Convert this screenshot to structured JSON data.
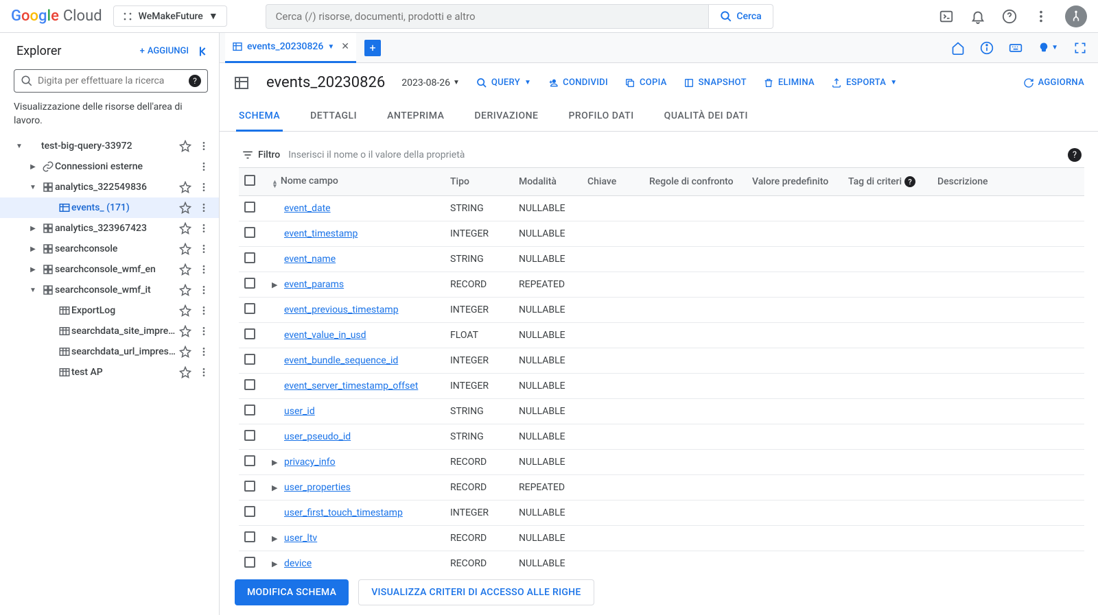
{
  "topbar": {
    "logo_cloud": "Cloud",
    "project": "WeMakeFuture",
    "search_placeholder": "Cerca (/) risorse, documenti, prodotti e altro",
    "search_btn": "Cerca"
  },
  "explorer": {
    "title": "Explorer",
    "add": "AGGIUNGI",
    "search_placeholder": "Digita per effettuare la ricerca",
    "hint": "Visualizzazione delle risorse dell'area di lavoro.",
    "tree": [
      {
        "lvl": 0,
        "icon": "caret-down",
        "ric": "",
        "label": "test-big-query-33972",
        "star": true,
        "more": true
      },
      {
        "lvl": 1,
        "icon": "caret-right",
        "ric": "link",
        "label": "Connessioni esterne",
        "star": false,
        "more": true
      },
      {
        "lvl": 1,
        "icon": "caret-down",
        "ric": "dataset",
        "label": "analytics_322549836",
        "star": true,
        "more": true
      },
      {
        "lvl": 2,
        "icon": "",
        "ric": "table-part",
        "label": "events_ (171)",
        "star": true,
        "more": true,
        "selected": true
      },
      {
        "lvl": 1,
        "icon": "caret-right",
        "ric": "dataset",
        "label": "analytics_323967423",
        "star": true,
        "more": true
      },
      {
        "lvl": 1,
        "icon": "caret-right",
        "ric": "dataset",
        "label": "searchconsole",
        "star": true,
        "more": true
      },
      {
        "lvl": 1,
        "icon": "caret-right",
        "ric": "dataset",
        "label": "searchconsole_wmf_en",
        "star": true,
        "more": true
      },
      {
        "lvl": 1,
        "icon": "caret-down",
        "ric": "dataset",
        "label": "searchconsole_wmf_it",
        "star": true,
        "more": true
      },
      {
        "lvl": 2,
        "icon": "",
        "ric": "table",
        "label": "ExportLog",
        "star": true,
        "more": true
      },
      {
        "lvl": 2,
        "icon": "",
        "ric": "table",
        "label": "searchdata_site_impres...",
        "star": true,
        "more": true
      },
      {
        "lvl": 2,
        "icon": "",
        "ric": "table",
        "label": "searchdata_url_impress...",
        "star": true,
        "more": true
      },
      {
        "lvl": 2,
        "icon": "",
        "ric": "table",
        "label": "test AP",
        "star": true,
        "more": true
      }
    ]
  },
  "tab": {
    "label": "events_20230826"
  },
  "page": {
    "title": "events_20230826",
    "date": "2023-08-26",
    "actions": {
      "query": "QUERY",
      "share": "CONDIVIDI",
      "copy": "COPIA",
      "snapshot": "SNAPSHOT",
      "delete": "ELIMINA",
      "export": "ESPORTA",
      "refresh": "AGGIORNA"
    },
    "subtabs": [
      "SCHEMA",
      "DETTAGLI",
      "ANTEPRIMA",
      "DERIVAZIONE",
      "PROFILO DATI",
      "QUALITÀ DEI DATI"
    ]
  },
  "filter": {
    "label": "Filtro",
    "placeholder": "Inserisci il nome o il valore della proprietà"
  },
  "table": {
    "headers": {
      "name": "Nome campo",
      "type": "Tipo",
      "mode": "Modalità",
      "key": "Chiave",
      "collation": "Regole di confronto",
      "default": "Valore predefinito",
      "tags": "Tag di criteri",
      "desc": "Descrizione"
    },
    "rows": [
      {
        "name": "event_date",
        "type": "STRING",
        "mode": "NULLABLE",
        "expandable": false
      },
      {
        "name": "event_timestamp",
        "type": "INTEGER",
        "mode": "NULLABLE",
        "expandable": false
      },
      {
        "name": "event_name",
        "type": "STRING",
        "mode": "NULLABLE",
        "expandable": false
      },
      {
        "name": "event_params",
        "type": "RECORD",
        "mode": "REPEATED",
        "expandable": true
      },
      {
        "name": "event_previous_timestamp",
        "type": "INTEGER",
        "mode": "NULLABLE",
        "expandable": false
      },
      {
        "name": "event_value_in_usd",
        "type": "FLOAT",
        "mode": "NULLABLE",
        "expandable": false
      },
      {
        "name": "event_bundle_sequence_id",
        "type": "INTEGER",
        "mode": "NULLABLE",
        "expandable": false
      },
      {
        "name": "event_server_timestamp_offset",
        "type": "INTEGER",
        "mode": "NULLABLE",
        "expandable": false
      },
      {
        "name": "user_id",
        "type": "STRING",
        "mode": "NULLABLE",
        "expandable": false
      },
      {
        "name": "user_pseudo_id",
        "type": "STRING",
        "mode": "NULLABLE",
        "expandable": false
      },
      {
        "name": "privacy_info",
        "type": "RECORD",
        "mode": "NULLABLE",
        "expandable": true
      },
      {
        "name": "user_properties",
        "type": "RECORD",
        "mode": "REPEATED",
        "expandable": true
      },
      {
        "name": "user_first_touch_timestamp",
        "type": "INTEGER",
        "mode": "NULLABLE",
        "expandable": false
      },
      {
        "name": "user_ltv",
        "type": "RECORD",
        "mode": "NULLABLE",
        "expandable": true
      },
      {
        "name": "device",
        "type": "RECORD",
        "mode": "NULLABLE",
        "expandable": true
      }
    ]
  },
  "bottom": {
    "edit": "MODIFICA SCHEMA",
    "view": "VISUALIZZA CRITERI DI ACCESSO ALLE RIGHE"
  }
}
